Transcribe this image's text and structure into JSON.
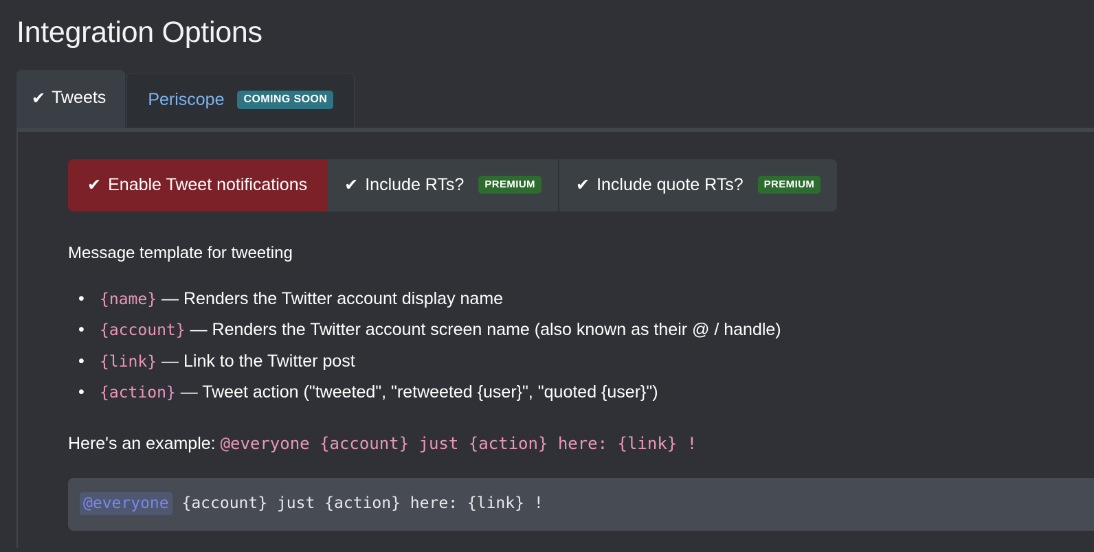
{
  "page": {
    "title": "Integration Options"
  },
  "tabs": [
    {
      "label": "Tweets",
      "icon": "check-icon",
      "check": "✔",
      "active": true,
      "badge": null
    },
    {
      "label": "Periscope",
      "icon": null,
      "check": null,
      "active": false,
      "badge": "COMING SOON"
    }
  ],
  "toggles": [
    {
      "label": "Enable Tweet notifications",
      "check": "✔",
      "enabled": true,
      "badge": null
    },
    {
      "label": "Include RTs?",
      "check": "✔",
      "enabled": false,
      "badge": "PREMIUM"
    },
    {
      "label": "Include quote RTs?",
      "check": "✔",
      "enabled": false,
      "badge": "PREMIUM"
    }
  ],
  "template_section": {
    "heading": "Message template for tweeting",
    "tokens": [
      {
        "token": "{name}",
        "desc": " — Renders the Twitter account display name"
      },
      {
        "token": "{account}",
        "desc": " — Renders the Twitter account screen name (also known as their @ / handle)"
      },
      {
        "token": "{link}",
        "desc": " — Link to the Twitter post"
      },
      {
        "token": "{action}",
        "desc": " — Tweet action (\"tweeted\", \"retweeted {user}\", \"quoted {user}\")"
      }
    ],
    "example_prefix": "Here's an example: ",
    "example_code": "@everyone {account} just {action} here: {link} !"
  },
  "preview": {
    "mention": "@everyone",
    "rest": " {account} just {action} here: {link} !"
  },
  "colors": {
    "page_bg": "#2f3136",
    "tab_active_bg": "#3a3f45",
    "tab_inactive_bg": "#2c2f33",
    "tab_inactive_text": "#7eb3ef",
    "toggle_on_bg": "#7d2129",
    "toggle_off_bg": "#3b4045",
    "badge_coming_soon_bg": "#2e7482",
    "badge_premium_bg": "#2d6b2f",
    "token_pink": "#e996bd",
    "preview_bg": "#474b54",
    "mention_text": "#7a85e8",
    "panel_border": "#41464d"
  }
}
